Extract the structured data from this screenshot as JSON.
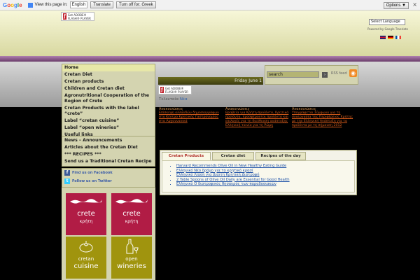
{
  "translate_bar": {
    "logo": [
      "G",
      "o",
      "o",
      "g",
      "l",
      "e"
    ],
    "view_text": "View this page in:",
    "language": "English",
    "translate_btn": "Translate",
    "turn_off_btn": "Turn off for: Greek",
    "options_btn": "Options ▼",
    "close": "×"
  },
  "header": {
    "flash_badge": "Get ADOBE® FLASH® PLAYER",
    "language_select": "Select Language",
    "powered_by": "Powered by Google Translate",
    "flags": [
      "uk-flag",
      "de-flag",
      "fr-flag"
    ]
  },
  "nav": {
    "items": [
      {
        "label": "Home",
        "active": true
      },
      {
        "label": "Cretan Diet"
      },
      {
        "label": "Cretan products"
      },
      {
        "label": "Children and Cretan diet"
      },
      {
        "label": "Agronutritional Cooperation of the Region of Crete"
      },
      {
        "label": "Cretan Products with the label “crete”"
      },
      {
        "label": "Label “cretan cuisine”"
      },
      {
        "label": "Label “open wineries”"
      },
      {
        "label": "Useful links"
      }
    ],
    "secondary": [
      {
        "label": "News – Announcements"
      },
      {
        "label": "Articles about the Cretan Diet"
      },
      {
        "label": "*** RECIPES ***"
      },
      {
        "label": "Send us a Traditional Cretan Recipe"
      }
    ]
  },
  "social": {
    "facebook": "Find us on Facebook",
    "twitter": "Follow us on Twitter"
  },
  "tiles": {
    "crete1": "crete",
    "crete1_gr": "κρήτη",
    "crete2": "crete",
    "crete2_gr": "κρήτη",
    "cuisine1": "cretan",
    "cuisine2": "cuisine",
    "wineries1": "open",
    "wineries2": "wineries"
  },
  "ticker": {
    "date": "Friday June 1"
  },
  "latest": {
    "label": "Τελευταία",
    "link": "Νέα"
  },
  "search": {
    "placeholder": "search",
    "rss": "RSS feed"
  },
  "news": [
    {
      "title": "Ανακοινώσεις",
      "body": "Επίσκεψη ολλανδών δημοσιογράφων στο Κέντρο Κρητικής Γαστρονομίας στα Αρχαννανικά"
    },
    {
      "title": "Ανακοινώσεις",
      "body": "Βραβεία για Κρήτη-προϊόντα, Κρητικά προϊόντα, προσφέρονται προϊόντα και επιλογές για τη διεύθυνση ανάπτυξης Ελληνική ταινία για τη Ρώμη"
    },
    {
      "title": "Ανακοινώσεις",
      "body": "Υπογράφεται Σύμφωνο για τη συνεργασία της Περιφέρειας Κρήτης με την Ελληνική Ανάπτυξη για τα προϊόντα με τη σήμανση 2012"
    }
  ],
  "tabs": {
    "items": [
      "Cretan Products",
      "Cretan diet",
      "Recipes of the day"
    ],
    "links": [
      "Harvard Recommends Olive Oil in New Healthy Eating Guide",
      "Ελληνικό Νέο δρόμο για το κρητικό κρασί",
      "Ελληνικό Λίαση για Δίαιτη Κρητική Διατροφή",
      "2 Table Spoons of Olive Oil Daily are Essential for Good Health",
      "Ελληνικό Ο διατροφικός θησαυρός των παραδοσιακών"
    ]
  }
}
